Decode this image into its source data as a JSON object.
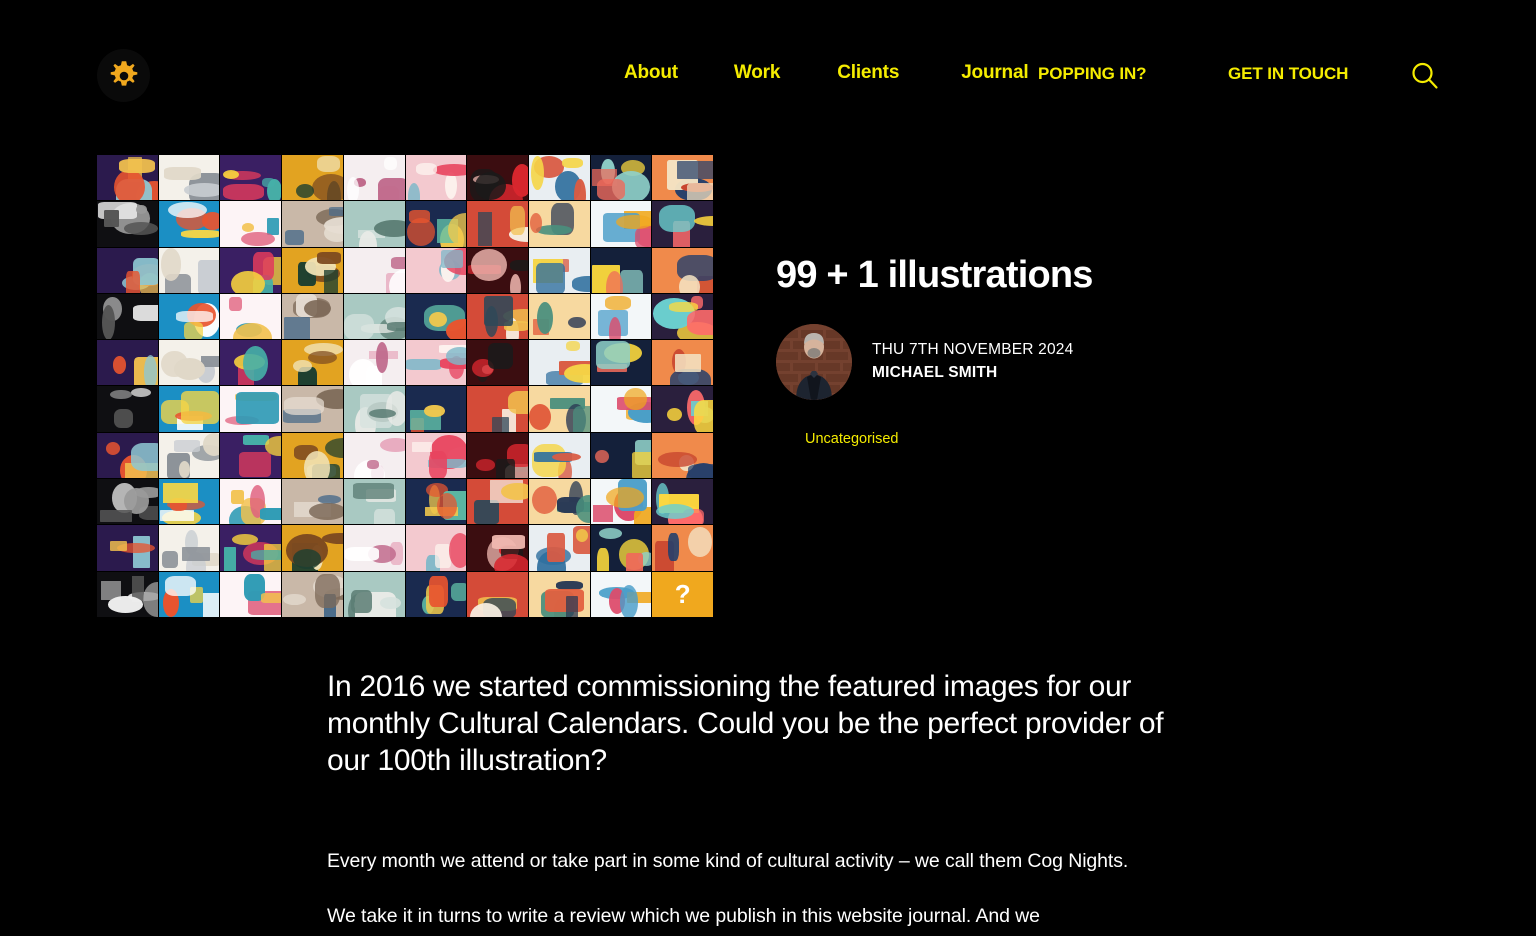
{
  "header": {
    "logo_icon": "gear-icon",
    "logo_color": "#f0a81e",
    "nav_primary": [
      {
        "label": "About"
      },
      {
        "label": "Work"
      },
      {
        "label": "Clients"
      },
      {
        "label": "Journal"
      }
    ],
    "popping_in_label": "POPPING IN?",
    "get_in_touch_label": "GET IN TOUCH",
    "search_icon": "search-icon",
    "accent_color": "#f5ec00"
  },
  "featured_image": {
    "alt": "Grid of 99 commissioned Cultural Calendar illustrations plus one empty slot",
    "columns": 10,
    "rows": 10,
    "final_tile_label": "?",
    "final_tile_color": "#f0a81e"
  },
  "article": {
    "title": "99 + 1 illustrations",
    "date": "THU 7TH NOVEMBER 2024",
    "author": "MICHAEL SMITH",
    "category": "Uncategorised",
    "lede": "In 2016 we started commissioning the featured images for our monthly Cultural Calendars. Could you be the perfect provider of our 100th illustration?",
    "paragraphs": [
      "Every month we attend or take part in some kind of cultural activity – we call them Cog Nights.",
      "We take it in turns to write a review which we publish in this website journal. And we"
    ]
  }
}
